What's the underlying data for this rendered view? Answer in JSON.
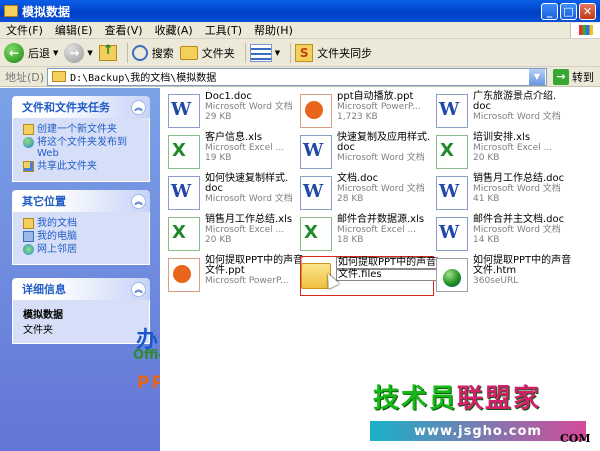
{
  "window": {
    "title": "模拟数据"
  },
  "menu": [
    "文件(F)",
    "编辑(E)",
    "查看(V)",
    "收藏(A)",
    "工具(T)",
    "帮助(H)"
  ],
  "toolbar": {
    "back": "后退",
    "search": "搜索",
    "folders": "文件夹",
    "sync": "文件夹同步"
  },
  "address": {
    "label": "地址(D)",
    "value": "D:\\Backup\\我的文档\\模拟数据",
    "go": "转到"
  },
  "tasks": {
    "title": "文件和文件夹任务",
    "items": [
      "创建一个新文件夹",
      "将这个文件夹发布到 Web",
      "共享此文件夹"
    ]
  },
  "places": {
    "title": "其它位置",
    "items": [
      "我的文档",
      "我的电脑",
      "网上邻居"
    ]
  },
  "details": {
    "title": "详细信息",
    "name": "模拟数据",
    "kind": "文件夹"
  },
  "files": [
    {
      "icon": "word",
      "name": "Doc1.doc",
      "type": "Microsoft Word 文档",
      "size": "29 KB"
    },
    {
      "icon": "ppt",
      "name": "ppt自动播放.ppt",
      "type": "Microsoft PowerP...",
      "size": "1,723 KB"
    },
    {
      "icon": "word",
      "name": "广东旅游景点介绍.",
      "name2": "doc",
      "type": "Microsoft Word 文档",
      "size": ""
    },
    {
      "icon": "excel",
      "name": "客户信息.xls",
      "type": "Microsoft Excel ...",
      "size": "19 KB"
    },
    {
      "icon": "word",
      "name": "快速复制及应用样式.",
      "name2": "doc",
      "type": "Microsoft Word 文档",
      "size": ""
    },
    {
      "icon": "excel",
      "name": "培训安排.xls",
      "type": "Microsoft Excel ...",
      "size": "20 KB"
    },
    {
      "icon": "word",
      "name": "如何快速复制样式.",
      "name2": "doc",
      "type": "Microsoft Word 文档",
      "size": ""
    },
    {
      "icon": "word",
      "name": "文档.doc",
      "type": "Microsoft Word 文档",
      "size": "28 KB"
    },
    {
      "icon": "word",
      "name": "销售月工作总结.doc",
      "type": "Microsoft Word 文档",
      "size": "41 KB"
    },
    {
      "icon": "excel",
      "name": "销售月工作总结.xls",
      "type": "Microsoft Excel ...",
      "size": "20 KB"
    },
    {
      "icon": "excel",
      "name": "邮件合并数据源.xls",
      "type": "Microsoft Excel ...",
      "size": "18 KB"
    },
    {
      "icon": "word",
      "name": "邮件合并主文档.doc",
      "type": "Microsoft Word 文档",
      "size": "14 KB"
    },
    {
      "icon": "ppt",
      "name": "如何提取PPT中的声音",
      "name2": "文件.ppt",
      "type": "Microsoft PowerP...",
      "size": ""
    },
    {
      "icon": "folder",
      "name": "如何提取PPT中的声音",
      "name2": "文件.files",
      "type": "",
      "size": "",
      "selected": true
    },
    {
      "icon": "htm",
      "name": "如何提取PPT中的声音",
      "name2": "文件.htm",
      "type": "360seURL",
      "size": ""
    }
  ],
  "watermarks": {
    "brand_cn": "办公族",
    "brand_url": "Officezu.com",
    "brand_sub": "PPT教程",
    "site_cn_a": "技术员",
    "site_cn_b": "联盟家",
    "site_url": "www.jsgho.com",
    "site_com": "COM"
  }
}
